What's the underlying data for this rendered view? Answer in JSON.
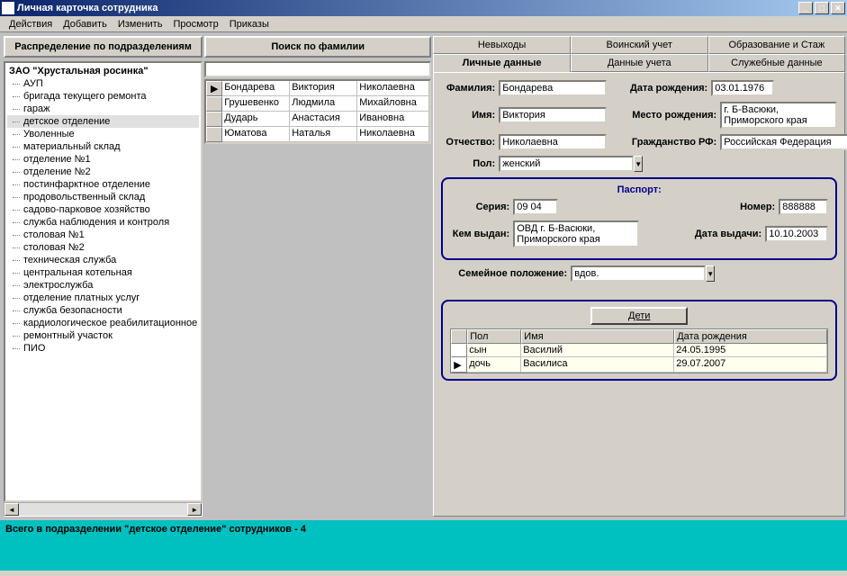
{
  "window": {
    "title": "Личная карточка сотрудника"
  },
  "menu": [
    "Действия",
    "Добавить",
    "Изменить",
    "Просмотр",
    "Приказы"
  ],
  "left": {
    "header": "Распределение по подразделениям",
    "root": "ЗАО \"Хрустальная росинка\"",
    "items": [
      "АУП",
      "бригада текущего ремонта",
      "гараж",
      "детское отделение",
      "Уволенные",
      "материальный склад",
      "отделение №1",
      "отделение №2",
      "постинфарктное отделение",
      "продовольственный склад",
      "садово-парковое хозяйство",
      "служба наблюдения и контроля",
      "столовая №1",
      "столовая №2",
      "техническая служба",
      "центральная котельная",
      "электрослужба",
      "отделение платных услуг",
      "служба безопасности",
      "кардиологическое реабилитационное",
      "ремонтный участок",
      "ПИО"
    ],
    "selected_index": 3
  },
  "search": {
    "header": "Поиск по фамилии",
    "value": ""
  },
  "employees": [
    {
      "ln": "Бондарева",
      "fn": "Виктория",
      "mn": "Николаевна"
    },
    {
      "ln": "Грушевенко",
      "fn": "Людмила",
      "mn": "Михайловна"
    },
    {
      "ln": "Дударь",
      "fn": "Анастасия",
      "mn": "Ивановна"
    },
    {
      "ln": "Юматова",
      "fn": "Наталья",
      "mn": "Николаевна"
    }
  ],
  "tabs_top": [
    "Невыходы",
    "Воинский учет",
    "Образование и Стаж"
  ],
  "tabs_bottom": [
    "Личные данные",
    "Данные учета",
    "Служебные данные"
  ],
  "labels": {
    "surname": "Фамилия:",
    "name": "Имя:",
    "patronymic": "Отчество:",
    "sex": "Пол:",
    "dob": "Дата рождения:",
    "pob": "Место рождения:",
    "citizenship": "Гражданство РФ:",
    "passport": "Паспорт:",
    "series": "Серия:",
    "number": "Номер:",
    "issued_by": "Кем выдан:",
    "issue_date": "Дата выдачи:",
    "marital": "Семейное положение:",
    "children": "Дети",
    "child_sex": "Пол",
    "child_name": "Имя",
    "child_dob": "Дата рождения"
  },
  "person": {
    "surname": "Бондарева",
    "name": "Виктория",
    "patronymic": "Николаевна",
    "sex": "женский",
    "dob": "03.01.1976",
    "pob": "г. Б-Васюки, Приморского края",
    "citizenship": "Российская Федерация",
    "passport_series": "09 04",
    "passport_number": "888888",
    "passport_issued_by": "ОВД г. Б-Васюки, Приморского края",
    "passport_issue_date": "10.10.2003",
    "marital": "вдов."
  },
  "children": [
    {
      "sex": "сын",
      "name": "Василий",
      "dob": "24.05.1995"
    },
    {
      "sex": "дочь",
      "name": "Василиса",
      "dob": "29.07.2007"
    }
  ],
  "status": "Всего в подразделении \"детское отделение\" сотрудников - 4"
}
